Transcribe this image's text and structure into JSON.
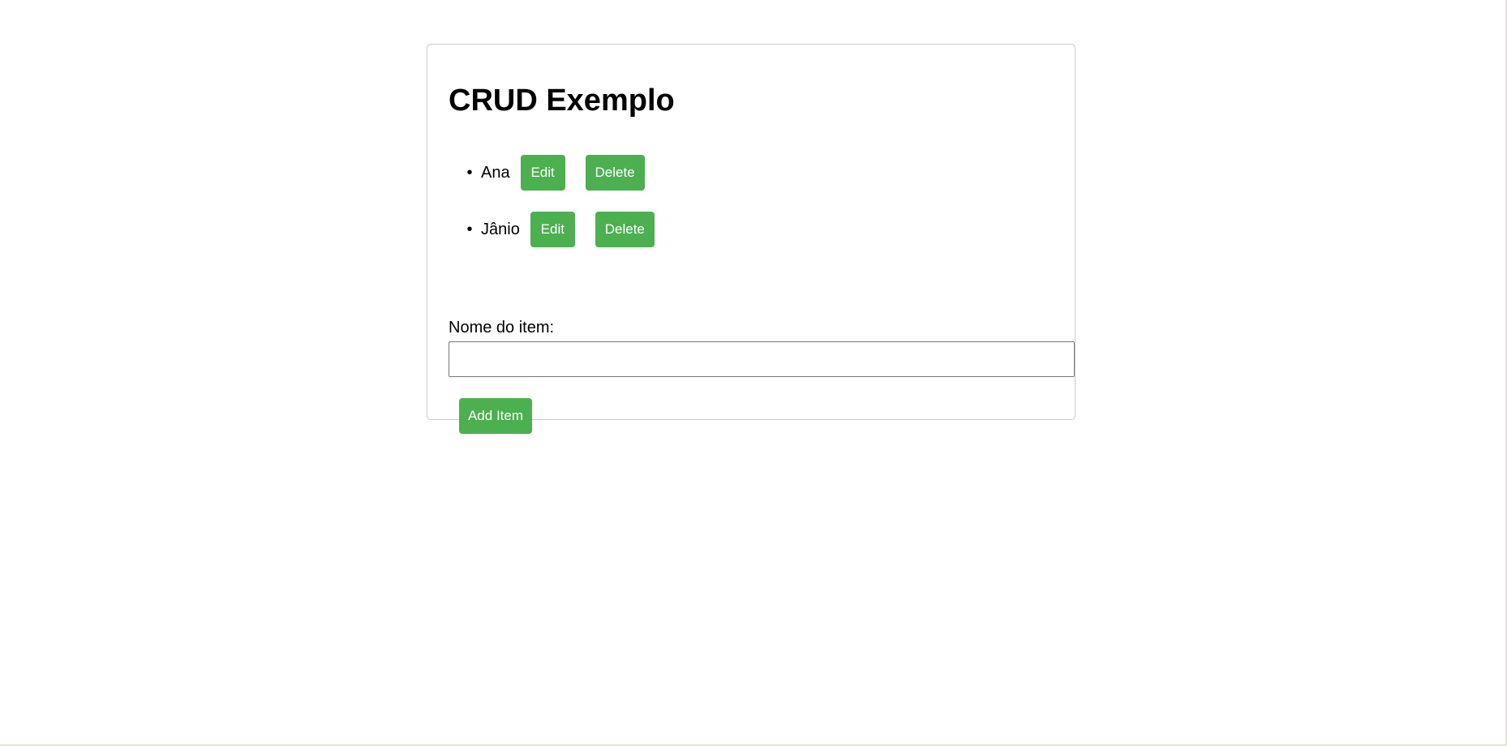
{
  "page": {
    "title": "CRUD Exemplo"
  },
  "items": [
    {
      "bullet": "•",
      "name": "Ana",
      "edit_label": "Edit",
      "delete_label": "Delete"
    },
    {
      "bullet": "•",
      "name": "Jânio",
      "edit_label": "Edit",
      "delete_label": "Delete"
    }
  ],
  "form": {
    "label": "Nome do item:",
    "input_value": "",
    "input_placeholder": "",
    "add_label": "Add Item"
  },
  "colors": {
    "button_bg": "#4caf50",
    "button_text": "#ffffff",
    "card_border": "#cccccc"
  }
}
